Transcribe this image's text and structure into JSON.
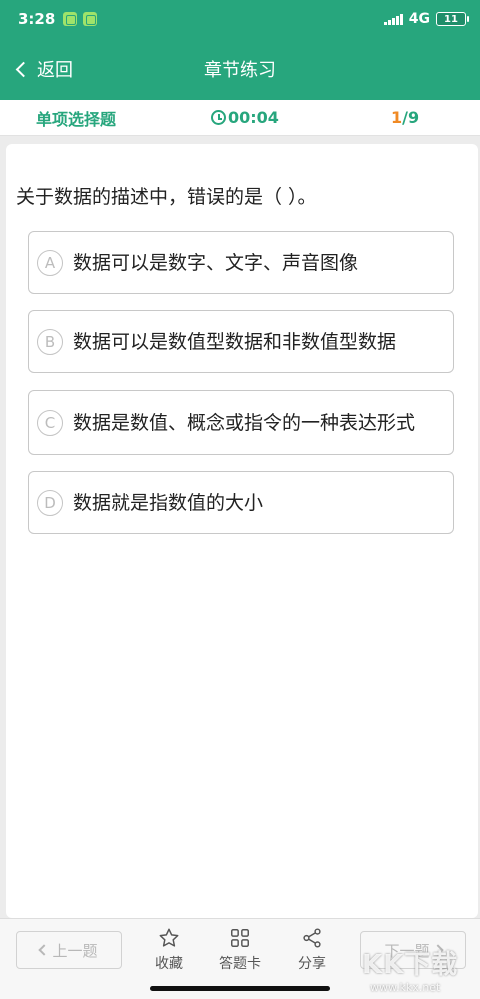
{
  "status_bar": {
    "time": "3:28",
    "network": "4G",
    "battery": "11"
  },
  "nav": {
    "back_label": "返回",
    "title": "章节练习"
  },
  "info": {
    "question_type": "单项选择题",
    "timer": "00:04",
    "current": "1",
    "separator": "/",
    "total": "9"
  },
  "question": {
    "text": "关于数据的描述中，错误的是（ ）。",
    "options": [
      {
        "letter": "A",
        "text": "数据可以是数字、文字、声音图像"
      },
      {
        "letter": "B",
        "text": "数据可以是数值型数据和非数值型数据"
      },
      {
        "letter": "C",
        "text": "数据是数值、概念或指令的一种表达形式"
      },
      {
        "letter": "D",
        "text": "数据就是指数值的大小"
      }
    ]
  },
  "toolbar": {
    "prev_label": "上一题",
    "next_label": "下一题",
    "favorite_label": "收藏",
    "answer_card_label": "答题卡",
    "share_label": "分享"
  },
  "watermark": {
    "logo": "KK下载",
    "url": "www.kkx.net"
  },
  "colors": {
    "primary": "#27a67d",
    "accent": "#f08a24"
  }
}
